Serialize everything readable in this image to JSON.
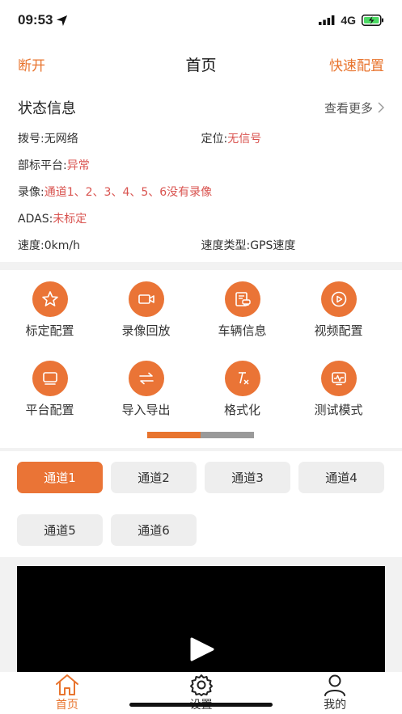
{
  "statusbar": {
    "time": "09:53",
    "network": "4G"
  },
  "navbar": {
    "left": "断开",
    "title": "首页",
    "right": "快速配置"
  },
  "status_info": {
    "title": "状态信息",
    "more": "查看更多",
    "dial_label": "拨号:",
    "dial_value": "无网络",
    "locate_label": "定位:",
    "locate_value": "无信号",
    "platform_label": "部标平台:",
    "platform_value": "异常",
    "record_label": "录像:",
    "record_value": "通道1、2、3、4、5、6没有录像",
    "adas_label": "ADAS:",
    "adas_value": "未标定",
    "speed_label": "速度:",
    "speed_value": "0km/h",
    "speedtype_label": "速度类型:",
    "speedtype_value": "GPS速度"
  },
  "grid": {
    "items": [
      {
        "label": "标定配置",
        "icon": "star-icon"
      },
      {
        "label": "录像回放",
        "icon": "video-camera-icon"
      },
      {
        "label": "车辆信息",
        "icon": "vehicle-info-icon"
      },
      {
        "label": "视频配置",
        "icon": "play-circle-icon"
      },
      {
        "label": "平台配置",
        "icon": "monitor-icon"
      },
      {
        "label": "导入导出",
        "icon": "swap-arrows-icon"
      },
      {
        "label": "格式化",
        "icon": "clear-format-icon"
      },
      {
        "label": "测试模式",
        "icon": "pulse-screen-icon"
      }
    ]
  },
  "channels": [
    "通道1",
    "通道2",
    "通道3",
    "通道4",
    "通道5",
    "通道6"
  ],
  "tabs": [
    {
      "label": "首页",
      "icon": "home-icon"
    },
    {
      "label": "设置",
      "icon": "gear-icon"
    },
    {
      "label": "我的",
      "icon": "user-icon"
    }
  ],
  "colors": {
    "accent": "#e8742e",
    "error": "#d9534f"
  }
}
